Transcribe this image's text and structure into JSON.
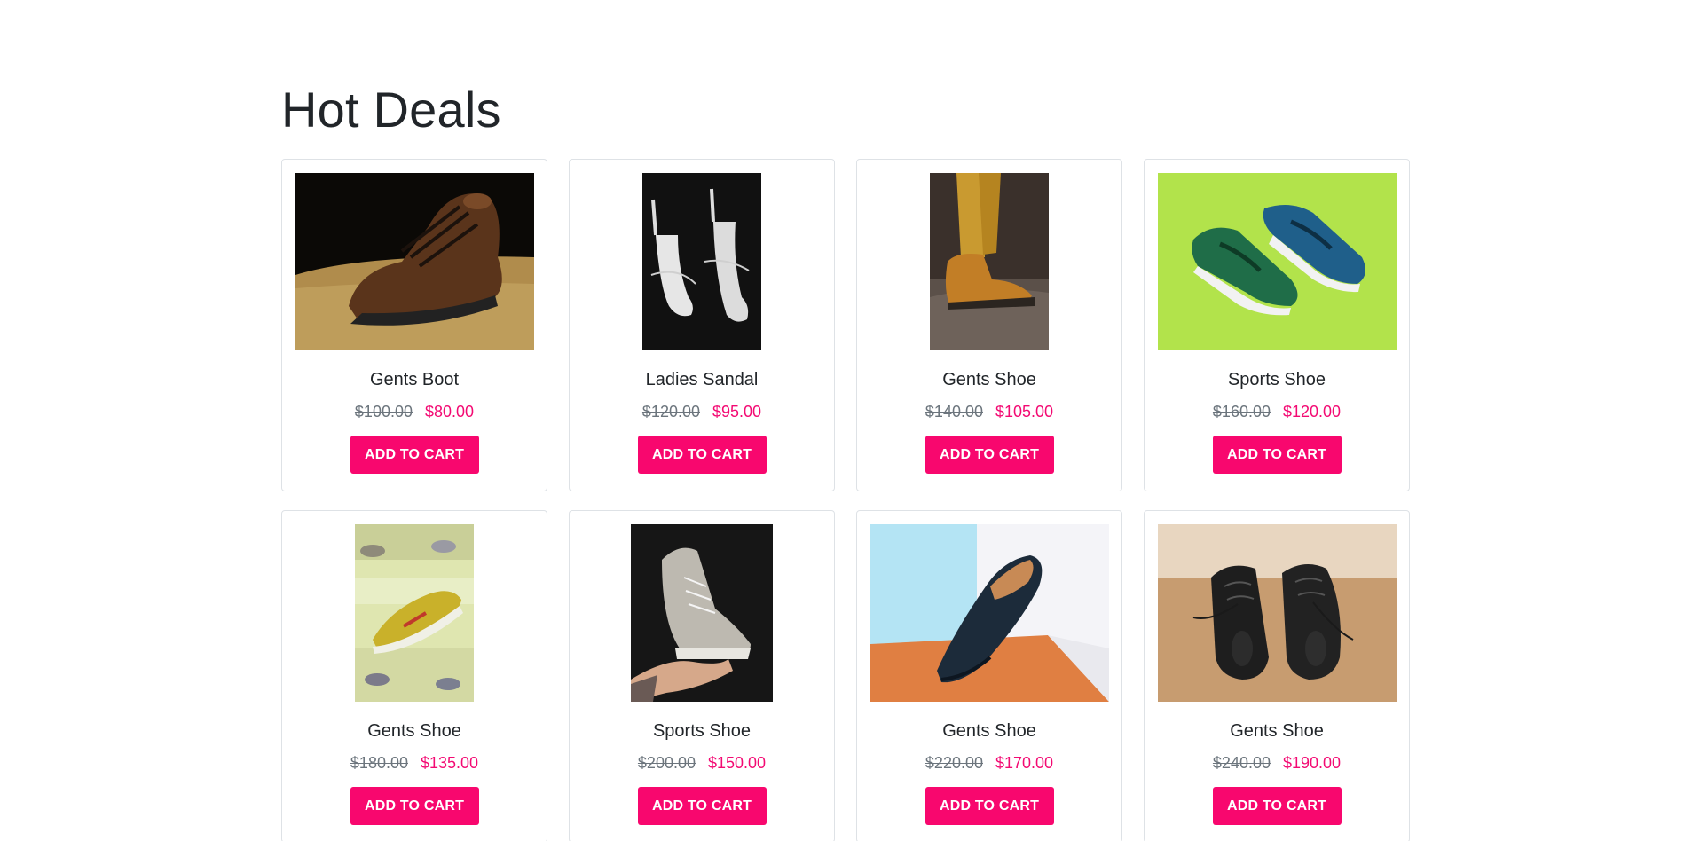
{
  "section": {
    "title": "Hot Deals"
  },
  "products": [
    {
      "name": "Gents Boot",
      "old_price": "$100.00",
      "price": "$80.00",
      "button": "ADD TO CART",
      "image": "gents-boot-image"
    },
    {
      "name": "Ladies Sandal",
      "old_price": "$120.00",
      "price": "$95.00",
      "button": "ADD TO CART",
      "image": "ladies-sandal-image"
    },
    {
      "name": "Gents Shoe",
      "old_price": "$140.00",
      "price": "$105.00",
      "button": "ADD TO CART",
      "image": "gents-shoe-image"
    },
    {
      "name": "Sports Shoe",
      "old_price": "$160.00",
      "price": "$120.00",
      "button": "ADD TO CART",
      "image": "sports-shoe-image"
    },
    {
      "name": "Gents Shoe",
      "old_price": "$180.00",
      "price": "$135.00",
      "button": "ADD TO CART",
      "image": "gents-shoe-image"
    },
    {
      "name": "Sports Shoe",
      "old_price": "$200.00",
      "price": "$150.00",
      "button": "ADD TO CART",
      "image": "sports-shoe-image"
    },
    {
      "name": "Gents Shoe",
      "old_price": "$220.00",
      "price": "$170.00",
      "button": "ADD TO CART",
      "image": "gents-shoe-image"
    },
    {
      "name": "Gents Shoe",
      "old_price": "$240.00",
      "price": "$190.00",
      "button": "ADD TO CART",
      "image": "gents-shoe-image"
    }
  ],
  "colors": {
    "accent": "#f8076e",
    "sale_price": "#f30a73",
    "old_price": "#6c757d"
  }
}
